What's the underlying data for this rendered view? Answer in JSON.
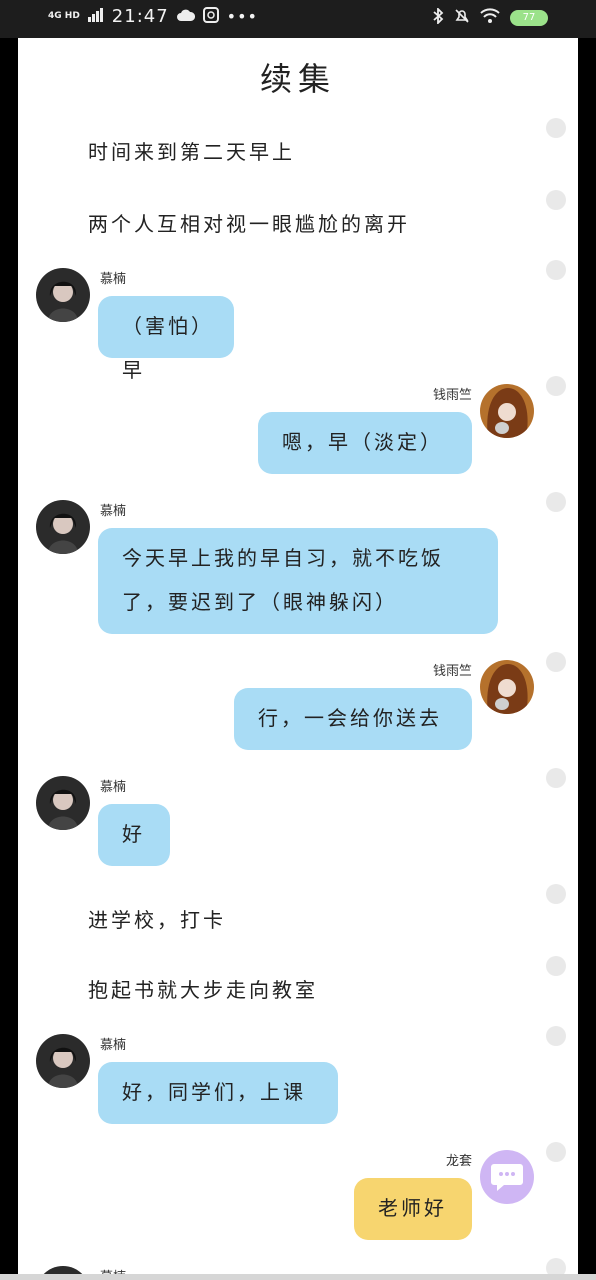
{
  "status_bar": {
    "network": "4G HD",
    "time": "21:47",
    "battery": "77"
  },
  "story": {
    "title": "续集",
    "items": [
      {
        "kind": "narration",
        "text": "时间来到第二天早上"
      },
      {
        "kind": "narration",
        "text": "两个人互相对视一眼尴尬的离开"
      },
      {
        "kind": "message",
        "side": "left",
        "sender": "慕楠",
        "text": "（害怕）早"
      },
      {
        "kind": "message",
        "side": "right",
        "sender": "钱雨竺",
        "text": "嗯，早（淡定）"
      },
      {
        "kind": "message",
        "side": "left",
        "sender": "慕楠",
        "text_line1": "今天早上我的早自习，就不吃饭",
        "text_line2": "了，要迟到了（眼神躲闪）"
      },
      {
        "kind": "message",
        "side": "right",
        "sender": "钱雨竺",
        "text": "行，一会给你送去"
      },
      {
        "kind": "message",
        "side": "left",
        "sender": "慕楠",
        "text": "好"
      },
      {
        "kind": "narration",
        "text": "进学校，打卡"
      },
      {
        "kind": "narration",
        "text": "抱起书就大步走向教室"
      },
      {
        "kind": "message",
        "side": "left",
        "sender": "慕楠",
        "text": "好，同学们，上课"
      },
      {
        "kind": "message",
        "side": "right",
        "sender": "龙套",
        "text": "老师好"
      },
      {
        "kind": "message",
        "side": "left",
        "sender": "慕楠"
      }
    ]
  },
  "colors": {
    "bubble_blue": "#a9dcf5",
    "bubble_yellow": "#f7d56f",
    "fab_purple": "#cfb6f4"
  }
}
